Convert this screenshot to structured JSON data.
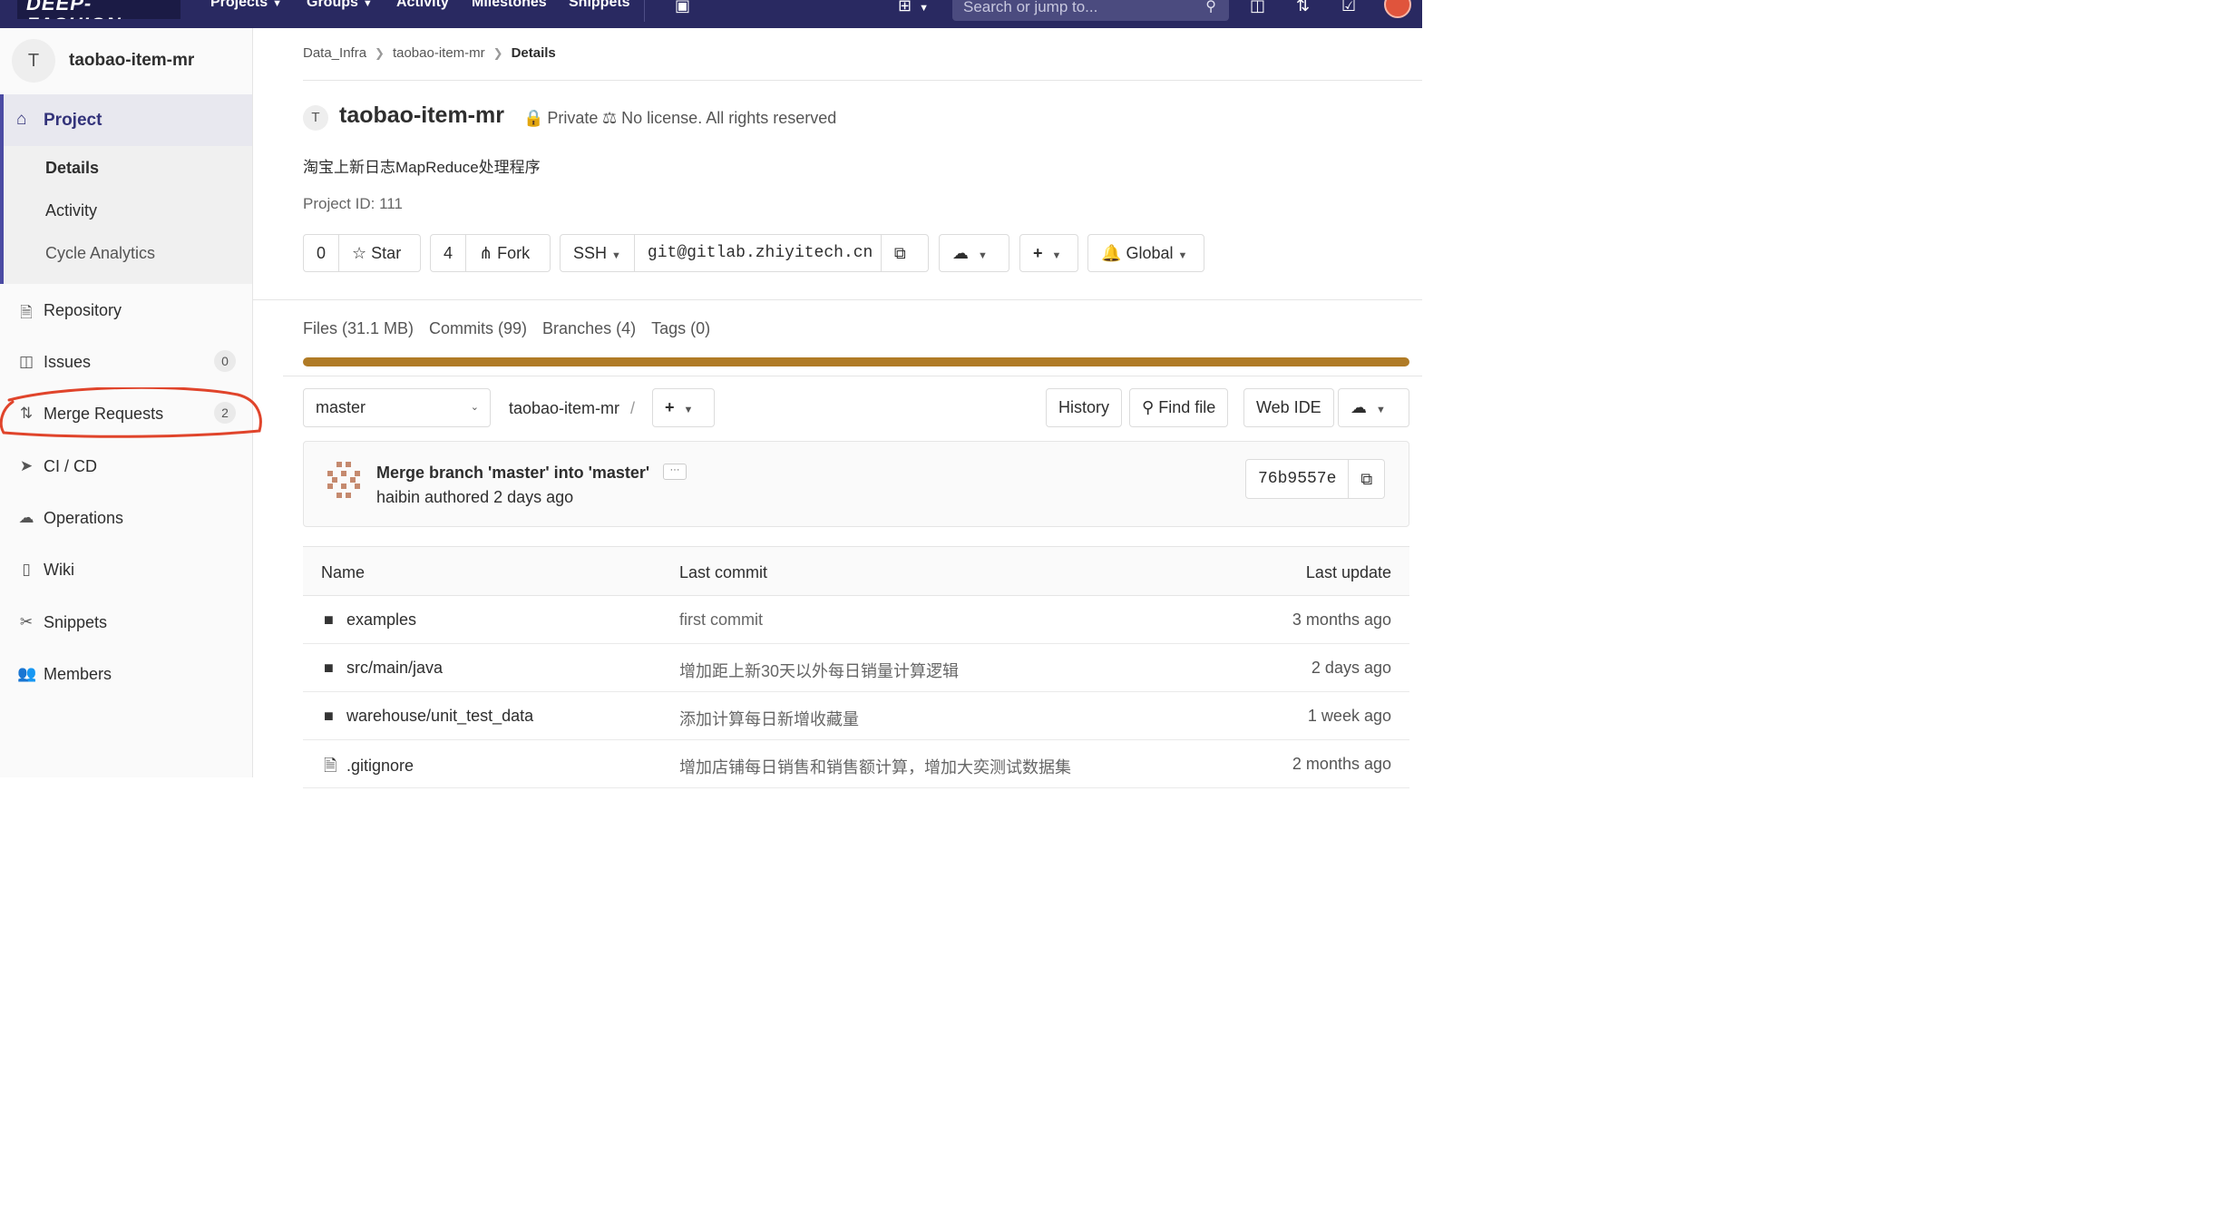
{
  "topnav": {
    "logo": "DEEP-FASHION",
    "items": [
      {
        "label": "Projects"
      },
      {
        "label": "Groups"
      },
      {
        "label": "Activity"
      },
      {
        "label": "Milestones"
      },
      {
        "label": "Snippets"
      }
    ],
    "search_placeholder": "Search or jump to..."
  },
  "sidebar": {
    "project_initial": "T",
    "project_name": "taobao-item-mr",
    "project_label": "Project",
    "sub_items": [
      "Details",
      "Activity",
      "Cycle Analytics"
    ],
    "items": [
      {
        "label": "Repository",
        "icon": "repository-icon"
      },
      {
        "label": "Issues",
        "icon": "issues-icon",
        "badge": "0"
      },
      {
        "label": "Merge Requests",
        "icon": "merge-request-icon",
        "badge": "2"
      },
      {
        "label": "CI / CD",
        "icon": "rocket-icon"
      },
      {
        "label": "Operations",
        "icon": "cloud-gear-icon"
      },
      {
        "label": "Wiki",
        "icon": "book-icon"
      },
      {
        "label": "Snippets",
        "icon": "scissors-icon"
      },
      {
        "label": "Members",
        "icon": "users-icon"
      }
    ],
    "annotation_color": "#e0442b"
  },
  "breadcrumb": {
    "items": [
      "Data_Infra",
      "taobao-item-mr"
    ],
    "current": "Details"
  },
  "project": {
    "initial": "T",
    "title": "taobao-item-mr",
    "visibility": "Private",
    "license": "No license. All rights reserved",
    "description": "淘宝上新日志MapReduce处理程序",
    "id_text": "Project ID: 111"
  },
  "actions": {
    "star_count": "0",
    "star_label": "Star",
    "fork_count": "4",
    "fork_label": "Fork",
    "protocol": "SSH",
    "clone_url": "git@gitlab.zhiyitech.cn",
    "notification": "Global"
  },
  "stats": {
    "files": "Files (31.1 MB)",
    "commits": "Commits (99)",
    "branches": "Branches (4)",
    "tags": "Tags (0)",
    "language_bar_color": "#b07b26"
  },
  "repo": {
    "branch": "master",
    "path": "taobao-item-mr",
    "path_sep": "/",
    "history": "History",
    "find_file": "Find file",
    "web_ide": "Web IDE"
  },
  "last_commit": {
    "title": "Merge branch 'master' into 'master'",
    "ellipsis": "···",
    "meta": "haibin authored 2 days ago",
    "sha": "76b9557e"
  },
  "table": {
    "headers": {
      "name": "Name",
      "last_commit": "Last commit",
      "last_update": "Last update"
    },
    "rows": [
      {
        "type": "folder",
        "name": "examples",
        "commit": "first commit",
        "update": "3 months ago"
      },
      {
        "type": "folder",
        "name": "src/main/java",
        "commit": "增加距上新30天以外每日销量计算逻辑",
        "update": "2 days ago"
      },
      {
        "type": "folder",
        "name": "warehouse/unit_test_data",
        "commit": "添加计算每日新增收藏量",
        "update": "1 week ago"
      },
      {
        "type": "file",
        "name": ".gitignore",
        "commit": "增加店铺每日销售和销售额计算，增加大奕测试数据集",
        "update": "2 months ago"
      }
    ]
  }
}
